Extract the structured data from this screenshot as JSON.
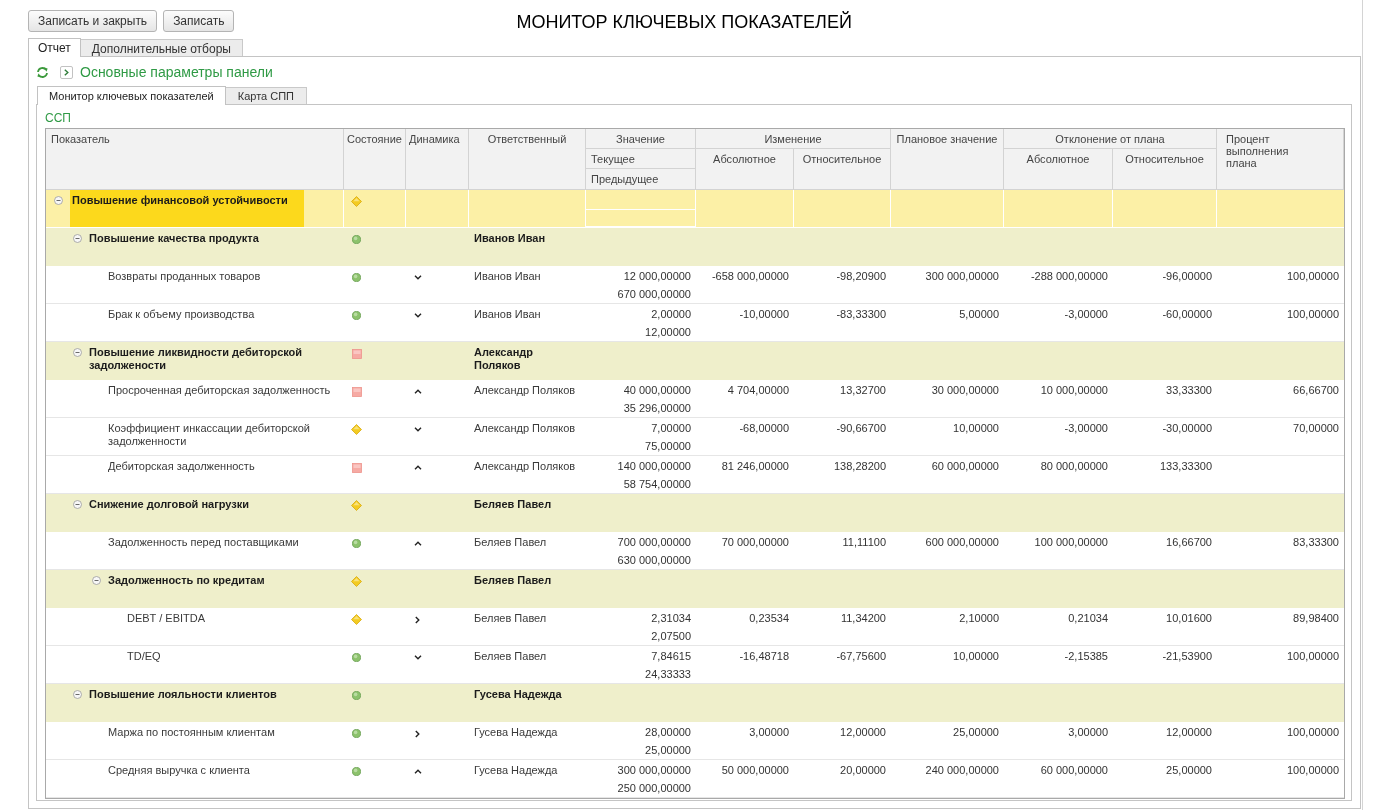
{
  "toolbar": {
    "buttons": [
      {
        "label": "Записать и закрыть"
      },
      {
        "label": "Записать"
      }
    ]
  },
  "title": "МОНИТОР КЛЮЧЕВЫХ ПОКАЗАТЕЛЕЙ",
  "tabs": [
    {
      "label": "Отчет",
      "selected": true
    },
    {
      "label": "Дополнительные отборы",
      "selected": false
    }
  ],
  "settings_panel": {
    "label": "Основные параметры панели",
    "expanded": false
  },
  "inner_tabs": [
    {
      "label": "Монитор ключевых показателей",
      "selected": true
    },
    {
      "label": "Карта СПП",
      "selected": false
    }
  ],
  "section_label": "ССП",
  "table": {
    "columns": [
      {
        "kind": "single",
        "label": "Показатель"
      },
      {
        "kind": "single",
        "label": "Состояние"
      },
      {
        "kind": "single",
        "label": "Динамика"
      },
      {
        "kind": "single",
        "label": "Ответственный"
      },
      {
        "kind": "stacked",
        "label": "Значение",
        "children": [
          {
            "label": "Текущее"
          },
          {
            "label": "Предыдущее"
          }
        ]
      },
      {
        "kind": "group",
        "label": "Изменение",
        "children": [
          {
            "label": "Абсолютное"
          },
          {
            "label": "Относительное"
          }
        ]
      },
      {
        "kind": "single",
        "label": "Плановое значение"
      },
      {
        "kind": "group",
        "label": "Отклонение от плана",
        "children": [
          {
            "label": "Абсолютное"
          },
          {
            "label": "Относительное"
          }
        ]
      },
      {
        "kind": "single",
        "label": "Процент выполнения плана"
      }
    ],
    "rows": [
      {
        "kind": "group",
        "name": "Повышение финансовой устойчивости",
        "status": {
          "kind": "warning"
        },
        "selected": true,
        "expanded": true,
        "children": [
          {
            "kind": "group",
            "name": "Повышение качества продукта",
            "status": {
              "kind": "good"
            },
            "responsible": "Иванов Иван",
            "selected": false,
            "expanded": true,
            "children": [
              {
                "kind": "item",
                "name": "Возвраты проданных товаров",
                "status": {
                  "kind": "good"
                },
                "trend": {
                  "kind": "falling"
                },
                "responsible": "Иванов Иван",
                "selected": false,
                "current": "12 000,00000",
                "previous": "670 000,00000",
                "change_abs": "-658 000,00000",
                "change_rel": "-98,20900",
                "plan": "300 000,00000",
                "deviation_abs": "-288 000,00000",
                "deviation_rel": "-96,00000",
                "percent": "100,00000"
              },
              {
                "kind": "item",
                "name": "Брак к объему производства",
                "status": {
                  "kind": "good"
                },
                "trend": {
                  "kind": "falling"
                },
                "responsible": "Иванов Иван",
                "selected": false,
                "current": "2,00000",
                "previous": "12,00000",
                "change_abs": "-10,00000",
                "change_rel": "-83,33300",
                "plan": "5,00000",
                "deviation_abs": "-3,00000",
                "deviation_rel": "-60,00000",
                "percent": "100,00000"
              }
            ]
          },
          {
            "kind": "group",
            "name": "Повышение ликвидности дебиторской задолжености",
            "status": {
              "kind": "bad"
            },
            "responsible": "Александр Поляков",
            "selected": false,
            "expanded": true,
            "children": [
              {
                "kind": "item",
                "name": "Просроченная дебиторская задолженность",
                "status": {
                  "kind": "bad"
                },
                "trend": {
                  "kind": "rising"
                },
                "responsible": "Александр Поляков",
                "selected": false,
                "current": "40 000,00000",
                "previous": "35 296,00000",
                "change_abs": "4 704,00000",
                "change_rel": "13,32700",
                "plan": "30 000,00000",
                "deviation_abs": "10 000,00000",
                "deviation_rel": "33,33300",
                "percent": "66,66700"
              },
              {
                "kind": "item",
                "name": "Коэффициент инкассации дебиторской задолженности",
                "status": {
                  "kind": "warning"
                },
                "trend": {
                  "kind": "falling"
                },
                "responsible": "Александр Поляков",
                "selected": false,
                "current": "7,00000",
                "previous": "75,00000",
                "change_abs": "-68,00000",
                "change_rel": "-90,66700",
                "plan": "10,00000",
                "deviation_abs": "-3,00000",
                "deviation_rel": "-30,00000",
                "percent": "70,00000"
              },
              {
                "kind": "item",
                "name": "Дебиторская задолженность",
                "status": {
                  "kind": "bad"
                },
                "trend": {
                  "kind": "rising"
                },
                "responsible": "Александр Поляков",
                "selected": false,
                "current": "140 000,00000",
                "previous": "58 754,00000",
                "change_abs": "81 246,00000",
                "change_rel": "138,28200",
                "plan": "60 000,00000",
                "deviation_abs": "80 000,00000",
                "deviation_rel": "133,33300"
              }
            ]
          },
          {
            "kind": "group",
            "name": "Снижение долговой нагрузки",
            "status": {
              "kind": "warning"
            },
            "responsible": "Беляев Павел",
            "selected": false,
            "expanded": true,
            "children": [
              {
                "kind": "item",
                "name": "Задолженность перед поставщиками",
                "status": {
                  "kind": "good"
                },
                "trend": {
                  "kind": "rising"
                },
                "responsible": "Беляев Павел",
                "selected": false,
                "current": "700 000,00000",
                "previous": "630 000,00000",
                "change_abs": "70 000,00000",
                "change_rel": "11,11100",
                "plan": "600 000,00000",
                "deviation_abs": "100 000,00000",
                "deviation_rel": "16,66700",
                "percent": "83,33300"
              },
              {
                "kind": "group",
                "name": "Задолженность по кредитам",
                "status": {
                  "kind": "warning"
                },
                "responsible": "Беляев Павел",
                "selected": false,
                "expanded": true,
                "children": [
                  {
                    "kind": "item",
                    "name": "DEBT / EBITDA",
                    "status": {
                      "kind": "warning"
                    },
                    "trend": {
                      "kind": "steady"
                    },
                    "responsible": "Беляев Павел",
                    "selected": false,
                    "current": "2,31034",
                    "previous": "2,07500",
                    "change_abs": "0,23534",
                    "change_rel": "11,34200",
                    "plan": "2,10000",
                    "deviation_abs": "0,21034",
                    "deviation_rel": "10,01600",
                    "percent": "89,98400"
                  },
                  {
                    "kind": "item",
                    "name": "TD/EQ",
                    "status": {
                      "kind": "good"
                    },
                    "trend": {
                      "kind": "falling"
                    },
                    "responsible": "Беляев Павел",
                    "selected": false,
                    "current": "7,84615",
                    "previous": "24,33333",
                    "change_abs": "-16,48718",
                    "change_rel": "-67,75600",
                    "plan": "10,00000",
                    "deviation_abs": "-2,15385",
                    "deviation_rel": "-21,53900",
                    "percent": "100,00000"
                  }
                ]
              }
            ]
          },
          {
            "kind": "group",
            "name": "Повышение лояльности клиентов",
            "status": {
              "kind": "good"
            },
            "responsible": "Гусева Надежда",
            "selected": false,
            "expanded": true,
            "children": [
              {
                "kind": "item",
                "name": "Маржа по постоянным клиентам",
                "status": {
                  "kind": "good"
                },
                "trend": {
                  "kind": "steady"
                },
                "responsible": "Гусева Надежда",
                "selected": false,
                "current": "28,00000",
                "previous": "25,00000",
                "change_abs": "3,00000",
                "change_rel": "12,00000",
                "plan": "25,00000",
                "deviation_abs": "3,00000",
                "deviation_rel": "12,00000",
                "percent": "100,00000"
              },
              {
                "kind": "item",
                "name": "Средняя выручка с клиента",
                "status": {
                  "kind": "good"
                },
                "trend": {
                  "kind": "rising"
                },
                "responsible": "Гусева Надежда",
                "selected": false,
                "current": "300 000,00000",
                "previous": "250 000,00000",
                "change_abs": "50 000,00000",
                "change_rel": "20,00000",
                "plan": "240 000,00000",
                "deviation_abs": "60 000,00000",
                "deviation_rel": "25,00000",
                "percent": "100,00000"
              }
            ]
          }
        ]
      }
    ]
  }
}
